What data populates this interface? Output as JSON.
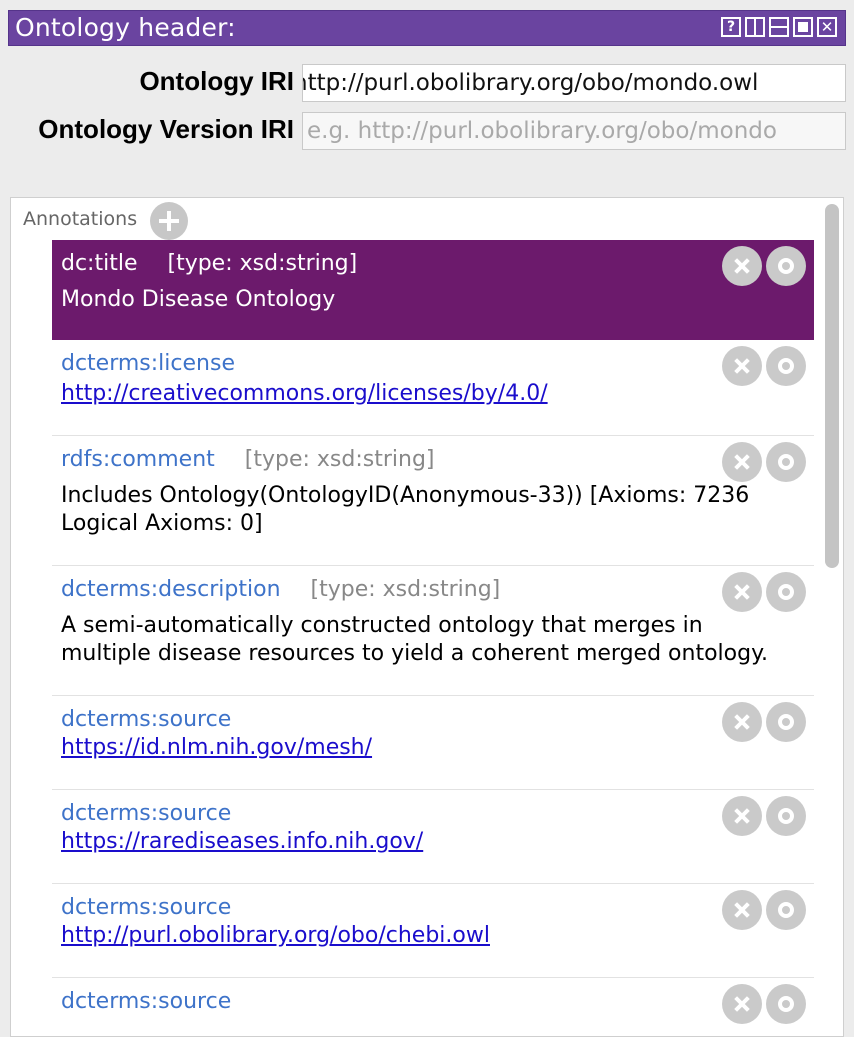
{
  "window": {
    "title": "Ontology header:",
    "controls": [
      "?",
      "restore",
      "minimize",
      "maximize",
      "close"
    ]
  },
  "header": {
    "iri_label": "Ontology IRI",
    "iri_value": "http://purl.obolibrary.org/obo/mondo.owl",
    "version_label": "Ontology Version IRI",
    "version_placeholder": "e.g. http://purl.obolibrary.org/obo/mondo"
  },
  "annotations": {
    "label": "Annotations",
    "items": [
      {
        "property": "dc:title",
        "type": "[type: xsd:string]",
        "lines": [
          "Mondo Disease Ontology"
        ],
        "link": false,
        "selected": true
      },
      {
        "property": "dcterms:license",
        "type": "",
        "lines": [
          "http://creativecommons.org/licenses/by/4.0/"
        ],
        "link": true,
        "selected": false
      },
      {
        "property": "rdfs:comment",
        "type": "[type: xsd:string]",
        "lines": [
          "Includes Ontology(OntologyID(Anonymous-33)) [Axioms: 7236",
          "Logical Axioms: 0]"
        ],
        "link": false,
        "selected": false
      },
      {
        "property": "dcterms:description",
        "type": "[type: xsd:string]",
        "lines": [
          "A semi-automatically constructed ontology that merges in",
          "multiple disease resources to yield a coherent merged ontology."
        ],
        "link": false,
        "selected": false
      },
      {
        "property": "dcterms:source",
        "type": "",
        "lines": [
          "https://id.nlm.nih.gov/mesh/"
        ],
        "link": true,
        "selected": false
      },
      {
        "property": "dcterms:source",
        "type": "",
        "lines": [
          "https://rarediseases.info.nih.gov/"
        ],
        "link": true,
        "selected": false
      },
      {
        "property": "dcterms:source",
        "type": "",
        "lines": [
          "http://purl.obolibrary.org/obo/chebi.owl"
        ],
        "link": true,
        "selected": false
      },
      {
        "property": "dcterms:source",
        "type": "",
        "lines": [],
        "link": true,
        "selected": false
      }
    ]
  },
  "colors": {
    "titlebar": "#6a44a0",
    "selected_row": "#6c1a6c",
    "property_text": "#3e73c9",
    "link_text": "#1a0dcc"
  }
}
